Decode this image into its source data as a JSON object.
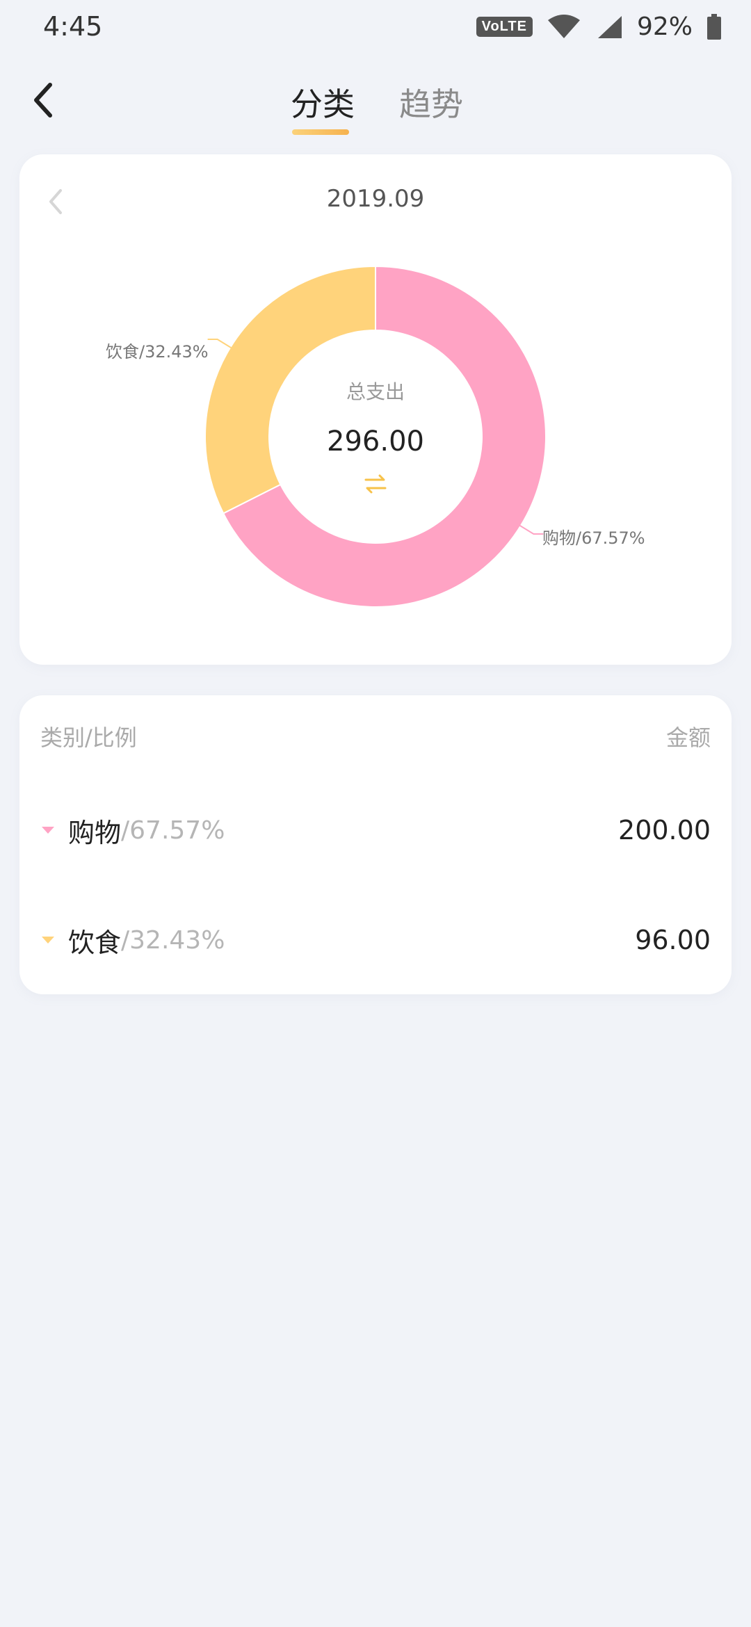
{
  "status": {
    "time": "4:45",
    "network": "VoLTE",
    "battery": "92%"
  },
  "header": {
    "tabs": [
      {
        "label": "分类",
        "active": true
      },
      {
        "label": "趋势",
        "active": false
      }
    ]
  },
  "chart_card": {
    "month": "2019.09",
    "center_title": "总支出",
    "total": "296.00"
  },
  "chart_data": {
    "type": "pie",
    "categories": [
      "购物",
      "饮食"
    ],
    "values": [
      200.0,
      96.0
    ],
    "percent": [
      67.57,
      32.43
    ],
    "colors": [
      "#ffa3c4",
      "#ffd37b"
    ],
    "labels": [
      "购物/67.57%",
      "饮食/32.43%"
    ]
  },
  "list": {
    "header_left": "类别/比例",
    "header_right": "金额",
    "rows": [
      {
        "name": "购物",
        "pct": "/67.57%",
        "amount": "200.00",
        "color": "#ffa3c4"
      },
      {
        "name": "饮食",
        "pct": "/32.43%",
        "amount": "96.00",
        "color": "#ffd37b"
      }
    ]
  }
}
